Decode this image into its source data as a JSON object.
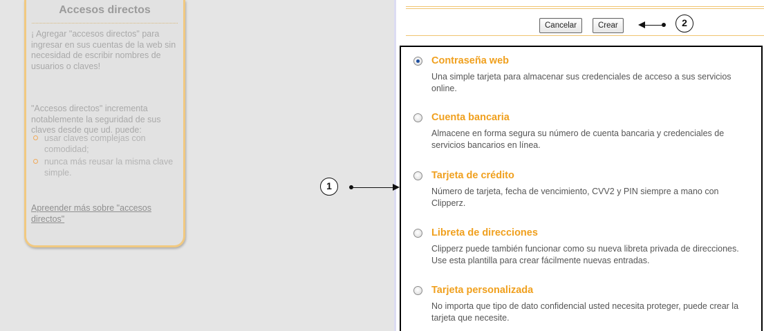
{
  "sidebar": {
    "title": "Accesos directos",
    "paragraph1": "¡ Agregar \"accesos directos\" para ingresar en sus cuentas de la web sin necesidad de escribir nombres de usuarios o claves!",
    "paragraph2": "\"Accesos directos\" incrementa notablemente la seguridad de sus claves desde que ud. puede:",
    "bullets": [
      "usar claves complejas con comodidad;",
      "nunca más reusar la misma clave simple."
    ],
    "learn_more_link": "Apreender más sobre \"accesos directos\""
  },
  "toolbar": {
    "cancel_label": "Cancelar",
    "create_label": "Crear"
  },
  "annotations": {
    "callout_1": "1",
    "callout_2": "2"
  },
  "templates": [
    {
      "title": "Contraseña web",
      "description": "Una simple tarjeta para almacenar sus credenciales de acceso a sus servicios online.",
      "selected": true
    },
    {
      "title": "Cuenta bancaria",
      "description": "Almacene en forma segura su número de cuenta bancaria y credenciales de servicios bancarios en línea.",
      "selected": false
    },
    {
      "title": "Tarjeta de crédito",
      "description": "Número de tarjeta, fecha de vencimiento, CVV2 y PIN siempre a mano con Clipperz.",
      "selected": false
    },
    {
      "title": "Libreta de direcciones",
      "description": "Clipperz puede también funcionar como su nueva libreta privada de direcciones. Use esta plantilla para crear fácilmente nuevas entradas.",
      "selected": false
    },
    {
      "title": "Tarjeta personalizada",
      "description": "No importa que tipo de dato confidencial usted necesita proteger, puede crear la tarjeta que necesite.",
      "selected": false
    }
  ],
  "colors": {
    "accent_orange": "#f0a01e",
    "panel_border": "#f1c981",
    "radio_selected": "#1f4f9f"
  }
}
